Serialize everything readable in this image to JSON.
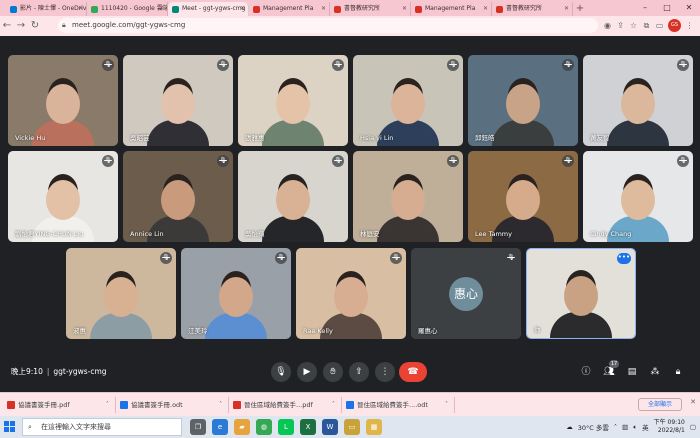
{
  "browser": {
    "tabs": [
      {
        "label": "影片 - 陳士懌 - OneDrive",
        "color": "#0078d4",
        "active": false
      },
      {
        "label": "1110420 - Google 雲端硬碟",
        "color": "#34a853",
        "active": false
      },
      {
        "label": "Meet - ggt-ygws-cmg",
        "color": "#00897b",
        "active": true
      },
      {
        "label": "Management Pla",
        "color": "#d93025",
        "active": false
      },
      {
        "label": "書督教研究所",
        "color": "#d93025",
        "active": false
      },
      {
        "label": "Management Pla",
        "color": "#d93025",
        "active": false
      },
      {
        "label": "書督教研究所",
        "color": "#d93025",
        "active": false
      }
    ],
    "url": "meet.google.com/ggt-ygws-cmg",
    "profile_initials": "GS"
  },
  "participants": [
    {
      "name": "Vickie Hu",
      "bg": "#8a7a6a",
      "skin": "#d9b39a",
      "shirt": "#b9705c"
    },
    {
      "name": "吳昭芸",
      "bg": "#cfc9c0",
      "skin": "#e2c2ad",
      "shirt": "#2f2f35"
    },
    {
      "name": "張雅惠",
      "bg": "#dcd3c4",
      "skin": "#e5c3a8",
      "shirt": "#6f8470"
    },
    {
      "name": "Hsia yi Lin",
      "bg": "#c8c4b8",
      "skin": "#dcb49a",
      "shirt": "#2d3f5a"
    },
    {
      "name": "邱鈺皓",
      "bg": "#5a6f7f",
      "skin": "#c9a388",
      "shirt": "#3b3e3f"
    },
    {
      "name": "黃友智",
      "bg": "#cfd1d4",
      "skin": "#dbb89c",
      "shirt": "#2c3540"
    },
    {
      "name": "劉怡君YING-CHUN Liu",
      "bg": "#e8e6e2",
      "skin": "#e3c1a6",
      "shirt": "#f2f0ec"
    },
    {
      "name": "Annice Lin",
      "bg": "#6b5c4c",
      "skin": "#c99b7c",
      "shirt": "#3b3a38"
    },
    {
      "name": "吳怡蘋",
      "bg": "#d8d5cf",
      "skin": "#d9b194",
      "shirt": "#24262a"
    },
    {
      "name": "林庭安",
      "bg": "#bfae98",
      "skin": "#d6ad90",
      "shirt": "#3a3532"
    },
    {
      "name": "Lee Tammy",
      "bg": "#8b6a44",
      "skin": "#d5ab8c",
      "shirt": "#2c2a2f"
    },
    {
      "name": "Cindy Chang",
      "bg": "#e6e7e9",
      "skin": "#dfbb9e",
      "shirt": "#6aa7c9"
    },
    {
      "name": "淑惠",
      "bg": "#cdb89e",
      "skin": "#d8b092",
      "shirt": "#8c9ea4"
    },
    {
      "name": "江美玲",
      "bg": "#9aa0a8",
      "skin": "#d2a78a",
      "shirt": "#5b8fd2"
    },
    {
      "name": "Rae Kelly",
      "bg": "#d8bfa3",
      "skin": "#d7ae91",
      "shirt": "#5c4b43"
    },
    {
      "name": "羅惠心",
      "initials": "惠心",
      "bg": "#3c4043"
    },
    {
      "name": "你",
      "bg": "#e3e0d9",
      "skin": "#c9a183",
      "shirt": "#2b2b2e"
    }
  ],
  "meeting": {
    "time": "晚上9:10",
    "code": "ggt-ygws-cmg",
    "participant_count": "17"
  },
  "icons": {
    "mic_off": "mic-off-icon",
    "mic": "mic-icon",
    "camera": "camera-icon",
    "hand": "raise-hand-icon",
    "present": "present-icon",
    "more": "more-vert-icon",
    "end_call": "end-call-icon",
    "info": "info-icon",
    "people": "people-icon",
    "chat": "chat-icon",
    "activities": "activities-icon",
    "host_controls": "host-controls-icon"
  },
  "downloads": [
    {
      "label": "協議書簽手冊.pdf",
      "type": "pdf",
      "color": "#d93025"
    },
    {
      "label": "協議書簽手冊.odt",
      "type": "odt",
      "color": "#1a73e8"
    },
    {
      "label": "晉住區域給費簽手...pdf",
      "type": "pdf",
      "color": "#d93025"
    },
    {
      "label": "晉住區域給費簽手....odt",
      "type": "odt",
      "color": "#1a73e8"
    }
  ],
  "downloads_show_all": "全部顯示",
  "taskbar": {
    "search_placeholder": "在這裡輸入文字來搜尋",
    "weather": "30°C 多雲",
    "ime": "英",
    "time": "下午 09:10",
    "date": "2022/8/1"
  }
}
